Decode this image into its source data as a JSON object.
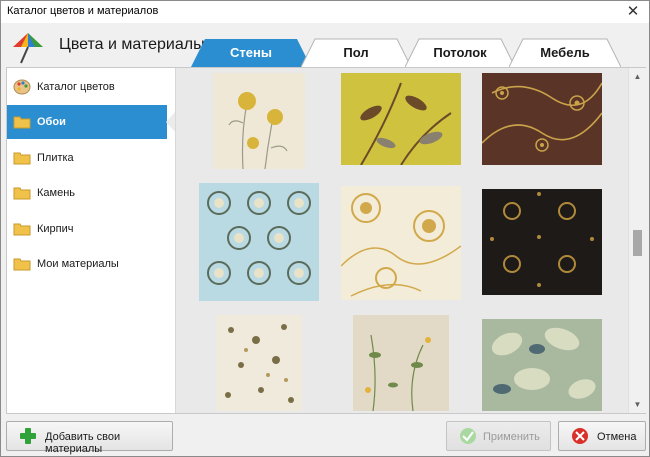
{
  "window": {
    "title": "Каталог цветов и материалов",
    "close_glyph": "✕"
  },
  "header": {
    "app_title": "Цвета и материалы",
    "logo_icon": "umbrella-icon"
  },
  "tabs": [
    {
      "label": "Стены",
      "active": true
    },
    {
      "label": "Пол",
      "active": false
    },
    {
      "label": "Потолок",
      "active": false
    },
    {
      "label": "Мебель",
      "active": false
    }
  ],
  "sidebar": {
    "items": [
      {
        "label": "Каталог цветов",
        "icon": "palette-icon",
        "active": false
      },
      {
        "label": "Обои",
        "icon": "folder-icon",
        "active": true
      },
      {
        "label": "Плитка",
        "icon": "folder-icon",
        "active": false
      },
      {
        "label": "Камень",
        "icon": "folder-icon",
        "active": false
      },
      {
        "label": "Кирпич",
        "icon": "folder-icon",
        "active": false
      },
      {
        "label": "Мои материалы",
        "icon": "folder-icon",
        "active": false
      }
    ]
  },
  "swatches": [
    {
      "name": "cream-yellow-flowers",
      "bg": "#efe8d6",
      "fg": "#d9b43a"
    },
    {
      "name": "olive-brown-leaves",
      "bg": "#cfc23e",
      "fg": "#6b4a2a"
    },
    {
      "name": "brown-gold-swirls",
      "bg": "#5a3426",
      "fg": "#c9a24a"
    },
    {
      "name": "blue-circles",
      "bg": "#b9d9e3",
      "fg": "#5a6b5a"
    },
    {
      "name": "cream-gold-flowers",
      "bg": "#f3ecd8",
      "fg": "#d2a94a"
    },
    {
      "name": "black-gold-damask",
      "bg": "#1d1a17",
      "fg": "#b08a3a"
    },
    {
      "name": "white-floral",
      "bg": "#efeadb",
      "fg": "#7a6e46"
    },
    {
      "name": "beige-botanical",
      "bg": "#e2dac6",
      "fg": "#6f8a4a"
    },
    {
      "name": "blue-green-leaves",
      "bg": "#a9b9a0",
      "fg": "#4f6a72"
    }
  ],
  "footer": {
    "add_label": "Добавить свои материалы",
    "add_icon": "plus-icon",
    "apply_label": "Применить",
    "apply_icon": "check-icon",
    "cancel_label": "Отмена",
    "cancel_icon": "cancel-icon"
  },
  "colors": {
    "accent": "#2a8ed1",
    "tab_active": "#2a8ed1"
  }
}
